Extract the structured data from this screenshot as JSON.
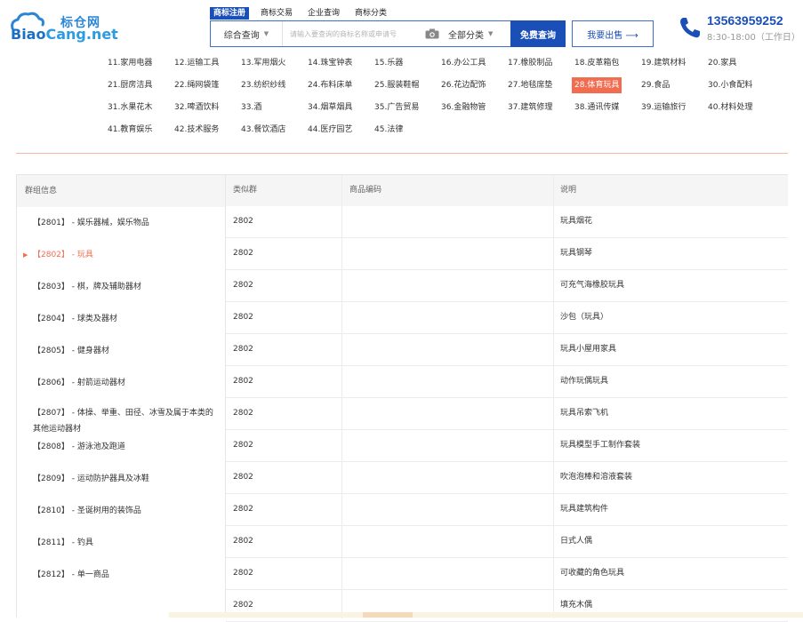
{
  "header": {
    "logo_cn": "标仓网",
    "logo_en_a": "Biao",
    "logo_en_b": "Cang.net",
    "search_tabs": [
      "商标注册",
      "商标交易",
      "企业查询",
      "商标分类"
    ],
    "search_type": "综合查询",
    "search_placeholder": "请输入要查询的商标名称或申请号",
    "class_select": "全部分类",
    "search_button": "免费查询",
    "sell_button": "我要出售 ⟶",
    "phone": "13563959252",
    "hours": "8:30-18:00（工作日）"
  },
  "categories": [
    "11.家用电器",
    "12.运输工具",
    "13.军用烟火",
    "14.珠宝钟表",
    "15.乐器",
    "16.办公工具",
    "17.橡胶制品",
    "18.皮革箱包",
    "19.建筑材料",
    "20.家具",
    "21.厨房洁具",
    "22.绳网袋篷",
    "23.纺织纱线",
    "24.布料床单",
    "25.服装鞋帽",
    "26.花边配饰",
    "27.地毯席垫",
    "28.体育玩具",
    "29.食品",
    "30.小食配料",
    "31.水果花木",
    "32.啤酒饮料",
    "33.酒",
    "34.烟草烟具",
    "35.广告贸易",
    "36.金融物管",
    "37.建筑修理",
    "38.通讯传媒",
    "39.运输旅行",
    "40.材料处理",
    "41.教育娱乐",
    "42.技术服务",
    "43.餐饮酒店",
    "44.医疗园艺",
    "45.法律"
  ],
  "active_category": "28.体育玩具",
  "group_panel": {
    "header": "群组信息",
    "items": [
      "【2801】 - 娱乐器械，娱乐物品",
      "【2802】 - 玩具",
      "【2803】 - 棋，牌及辅助器材",
      "【2804】 - 球类及器材",
      "【2805】 - 健身器材",
      "【2806】 - 射箭运动器材",
      "【2807】 - 体操、举重、田径、冰雪及属于本类的其他运动器材",
      "【2808】 - 游泳池及跑道",
      "【2809】 - 运动防护器具及冰鞋",
      "【2810】 - 圣诞树用的装饰品",
      "【2811】 - 钓具",
      "【2812】 - 单一商品"
    ],
    "active_index": 1
  },
  "table": {
    "headers": [
      "类似群",
      "商品编码",
      "说明"
    ],
    "rows": [
      {
        "group": "2802",
        "code": "",
        "desc": "玩具烟花"
      },
      {
        "group": "2802",
        "code": "",
        "desc": "玩具钢琴"
      },
      {
        "group": "2802",
        "code": "",
        "desc": "可充气海橡胶玩具"
      },
      {
        "group": "2802",
        "code": "",
        "desc": "沙包（玩具）"
      },
      {
        "group": "2802",
        "code": "",
        "desc": "玩具小屋用家具"
      },
      {
        "group": "2802",
        "code": "",
        "desc": "动作玩偶玩具"
      },
      {
        "group": "2802",
        "code": "",
        "desc": "玩具吊索飞机"
      },
      {
        "group": "2802",
        "code": "",
        "desc": "玩具模型手工制作套装"
      },
      {
        "group": "2802",
        "code": "",
        "desc": "吹泡泡棒和溶液套装"
      },
      {
        "group": "2802",
        "code": "",
        "desc": "玩具建筑构件"
      },
      {
        "group": "2802",
        "code": "",
        "desc": "日式人偶"
      },
      {
        "group": "2802",
        "code": "",
        "desc": "可收藏的角色玩具"
      },
      {
        "group": "2802",
        "code": "",
        "desc": "填充木偶"
      }
    ]
  }
}
